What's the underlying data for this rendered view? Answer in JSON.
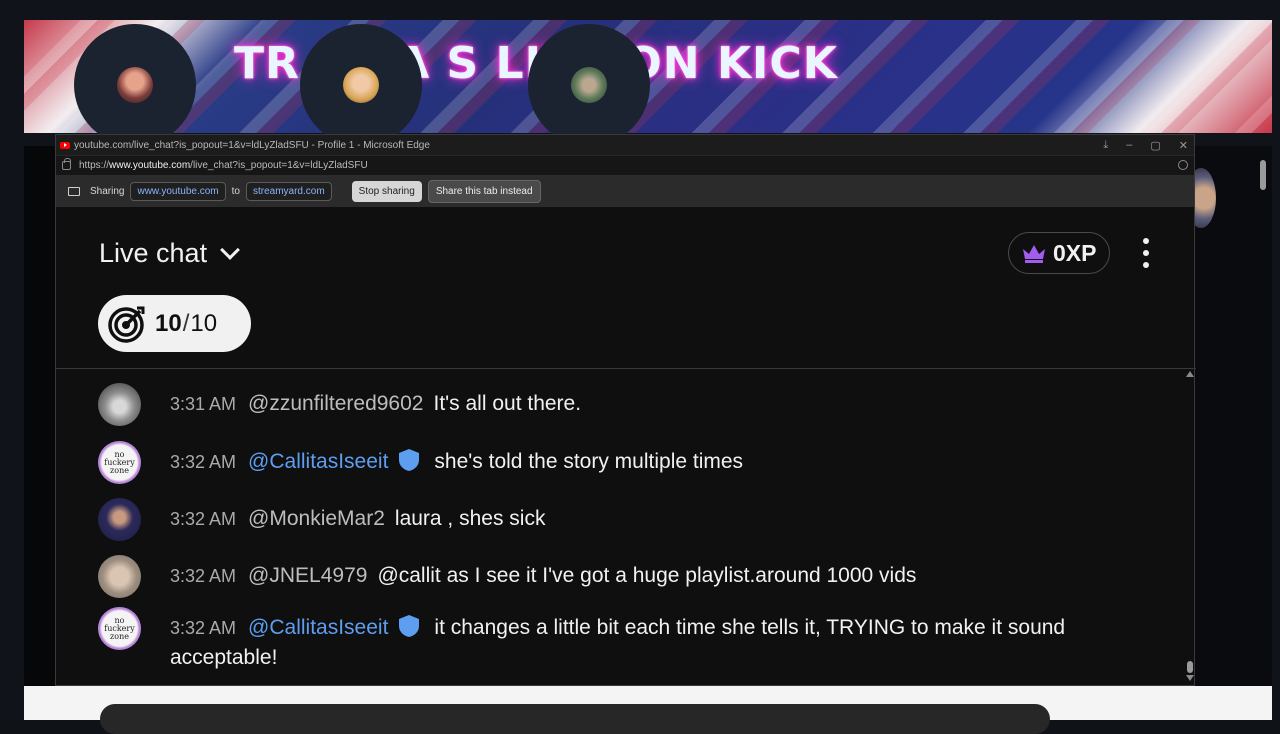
{
  "stream": {
    "banner_text": "TR      A TA     S LIVE ON KICK"
  },
  "window": {
    "title": "youtube.com/live_chat?is_popout=1&v=ldLyZladSFU - Profile 1 - Microsoft Edge",
    "url_prefix": "https://",
    "url_host": "www.youtube.com",
    "url_path": "/live_chat?is_popout=1&v=ldLyZladSFU"
  },
  "sharing": {
    "label": "Sharing",
    "source": "www.youtube.com",
    "to": "to",
    "target": "streamyard.com",
    "stop_label": "Stop sharing",
    "share_tab_label": "Share this tab instead"
  },
  "chat": {
    "title": "Live chat",
    "xp": "0XP",
    "goal_current": "10",
    "goal_sep": "/",
    "goal_total": "10",
    "messages": [
      {
        "time": "3:31 AM",
        "author": "@zzunfiltered9602",
        "text": "It's all out there.",
        "member": false
      },
      {
        "time": "3:32 AM",
        "author": "@CallitasIseeit",
        "text": "she's told the story multiple times",
        "member": true
      },
      {
        "time": "3:32 AM",
        "author": "@MonkieMar2",
        "text": "laura , shes sick",
        "member": false
      },
      {
        "time": "3:32 AM",
        "author": "@JNEL4979",
        "text": "@callit as I see it I've got a huge playlist.around 1000 vids",
        "member": false
      },
      {
        "time": "3:32 AM",
        "author": "@CallitasIseeit",
        "text": "it changes a little bit each time she tells it, TRYING to make it sound acceptable!",
        "member": true
      }
    ],
    "avatar_badge_text": "no fuckery zone"
  },
  "colors": {
    "member_blue": "#5e9ef0",
    "crown_purple": "#a35bf0"
  }
}
